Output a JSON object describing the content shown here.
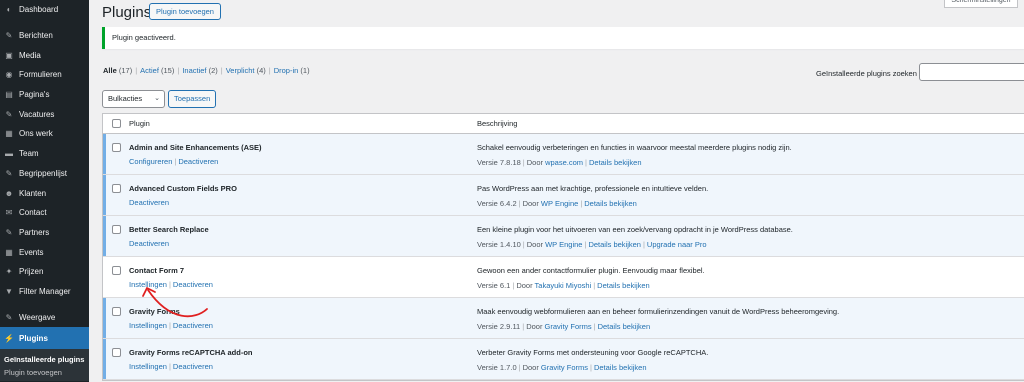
{
  "sidebar": {
    "items": [
      {
        "label": "Dashboard",
        "icon": "dashboard-icon",
        "glyph": "◐"
      },
      {
        "sep": true
      },
      {
        "label": "Berichten",
        "icon": "pin-icon",
        "glyph": "✎"
      },
      {
        "label": "Media",
        "icon": "media-icon",
        "glyph": "▣"
      },
      {
        "label": "Formulieren",
        "icon": "forms-icon",
        "glyph": "◉"
      },
      {
        "label": "Pagina's",
        "icon": "pages-icon",
        "glyph": "▤"
      },
      {
        "label": "Vacatures",
        "icon": "pin-icon",
        "glyph": "✎"
      },
      {
        "label": "Ons werk",
        "icon": "briefcase-icon",
        "glyph": "▦"
      },
      {
        "label": "Team",
        "icon": "team-icon",
        "glyph": "▬"
      },
      {
        "label": "Begrippenlijst",
        "icon": "pin-icon",
        "glyph": "✎"
      },
      {
        "label": "Klanten",
        "icon": "clients-icon",
        "glyph": "☻"
      },
      {
        "label": "Contact",
        "icon": "contact-icon",
        "glyph": "✉"
      },
      {
        "label": "Partners",
        "icon": "partners-icon",
        "glyph": "✎"
      },
      {
        "label": "Events",
        "icon": "events-icon",
        "glyph": "▦"
      },
      {
        "label": "Prijzen",
        "icon": "awards-icon",
        "glyph": "✦"
      },
      {
        "label": "Filter Manager",
        "icon": "filter-icon",
        "glyph": "▼"
      },
      {
        "sep": true
      },
      {
        "label": "Weergave",
        "icon": "appearance-icon",
        "glyph": "✎"
      },
      {
        "label": "Plugins",
        "icon": "plugin-icon",
        "glyph": "⚡",
        "active": true
      }
    ],
    "submenu": [
      {
        "label": "Geïnstalleerde plugins",
        "current": true
      },
      {
        "label": "Plugin toevoegen"
      }
    ]
  },
  "header": {
    "title": "Plugins",
    "add_new_label": "Plugin toevoegen",
    "screen_options_label": "Scherminstellingen"
  },
  "notice": {
    "text": "Plugin geactiveerd."
  },
  "filters": [
    {
      "label": "Alle",
      "count": "(17)",
      "current": true
    },
    {
      "label": "Actief",
      "count": "(15)"
    },
    {
      "label": "Inactief",
      "count": "(2)"
    },
    {
      "label": "Verplicht",
      "count": "(4)"
    },
    {
      "label": "Drop-in",
      "count": "(1)"
    }
  ],
  "search": {
    "label": "Geïnstalleerde plugins zoeken",
    "value": ""
  },
  "bulk": {
    "selected": "Bulkacties",
    "apply_label": "Toepassen"
  },
  "table": {
    "columns": {
      "plugin": "Plugin",
      "description": "Beschrijving"
    },
    "rows": [
      {
        "name": "Admin and Site Enhancements (ASE)",
        "active": true,
        "actions": [
          "Configureren",
          "Deactiveren"
        ],
        "description": "Schakel eenvoudig verbeteringen en functies in waarvoor meestal meerdere plugins nodig zijn.",
        "version": "Versie 7.8.18",
        "by_label": "Door",
        "author": "wpase.com",
        "links": [
          "Details bekijken"
        ]
      },
      {
        "name": "Advanced Custom Fields PRO",
        "active": true,
        "actions": [
          "Deactiveren"
        ],
        "description": "Pas WordPress aan met krachtige, professionele en intuïtieve velden.",
        "version": "Versie 6.4.2",
        "by_label": "Door",
        "author": "WP Engine",
        "links": [
          "Details bekijken"
        ]
      },
      {
        "name": "Better Search Replace",
        "active": true,
        "actions": [
          "Deactiveren"
        ],
        "description": "Een kleine plugin voor het uitvoeren van een zoek/vervang opdracht in je WordPress database.",
        "version": "Versie 1.4.10",
        "by_label": "Door",
        "author": "WP Engine",
        "links": [
          "Details bekijken",
          "Upgrade naar Pro"
        ]
      },
      {
        "name": "Contact Form 7",
        "active": false,
        "actions": [
          "Instellingen",
          "Deactiveren"
        ],
        "description": "Gewoon een ander contactformulier plugin. Eenvoudig maar flexibel.",
        "version": "Versie 6.1",
        "by_label": "Door",
        "author": "Takayuki Miyoshi",
        "links": [
          "Details bekijken"
        ]
      },
      {
        "name": "Gravity Forms",
        "active": true,
        "actions": [
          "Instellingen",
          "Deactiveren"
        ],
        "description": "Maak eenvoudig webformulieren aan en beheer formulierinzendingen vanuit de WordPress beheeromgeving.",
        "version": "Versie 2.9.11",
        "by_label": "Door",
        "author": "Gravity Forms",
        "links": [
          "Details bekijken"
        ]
      },
      {
        "name": "Gravity Forms reCAPTCHA add-on",
        "active": true,
        "actions": [
          "Instellingen",
          "Deactiveren"
        ],
        "description": "Verbeter Gravity Forms met ondersteuning voor Google reCAPTCHA.",
        "version": "Versie 1.7.0",
        "by_label": "Door",
        "author": "Gravity Forms",
        "links": [
          "Details bekijken"
        ]
      }
    ]
  },
  "annotation": {
    "color": "#e02020"
  }
}
